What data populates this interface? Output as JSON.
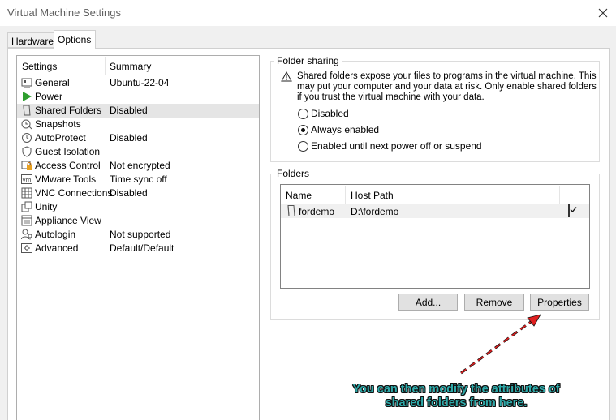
{
  "window": {
    "title": "Virtual Machine Settings"
  },
  "tabs": [
    {
      "label": "Hardware",
      "active": false
    },
    {
      "label": "Options",
      "active": true
    }
  ],
  "settings": {
    "col_settings": "Settings",
    "col_summary": "Summary",
    "items": [
      {
        "label": "General",
        "summary": "Ubuntu-22-04",
        "icon": "general-icon"
      },
      {
        "label": "Power",
        "summary": "",
        "icon": "power-icon"
      },
      {
        "label": "Shared Folders",
        "summary": "Disabled",
        "icon": "shared-folders-icon",
        "selected": true
      },
      {
        "label": "Snapshots",
        "summary": "",
        "icon": "snapshots-icon"
      },
      {
        "label": "AutoProtect",
        "summary": "Disabled",
        "icon": "autoprotect-icon"
      },
      {
        "label": "Guest Isolation",
        "summary": "",
        "icon": "guest-isolation-icon"
      },
      {
        "label": "Access Control",
        "summary": "Not encrypted",
        "icon": "access-control-icon"
      },
      {
        "label": "VMware Tools",
        "summary": "Time sync off",
        "icon": "vmware-tools-icon"
      },
      {
        "label": "VNC Connections",
        "summary": "Disabled",
        "icon": "vnc-icon"
      },
      {
        "label": "Unity",
        "summary": "",
        "icon": "unity-icon"
      },
      {
        "label": "Appliance View",
        "summary": "",
        "icon": "appliance-view-icon"
      },
      {
        "label": "Autologin",
        "summary": "Not supported",
        "icon": "autologin-icon"
      },
      {
        "label": "Advanced",
        "summary": "Default/Default",
        "icon": "advanced-icon"
      }
    ]
  },
  "folder_sharing": {
    "title": "Folder sharing",
    "warning": "Shared folders expose your files to programs in the virtual machine. This may put your computer and your data at risk. Only enable shared folders if you trust the virtual machine with your data.",
    "options": [
      {
        "label": "Disabled",
        "selected": false
      },
      {
        "label": "Always enabled",
        "selected": true
      },
      {
        "label": "Enabled until next power off or suspend",
        "selected": false
      }
    ]
  },
  "folders": {
    "title": "Folders",
    "col_name": "Name",
    "col_host_path": "Host Path",
    "rows": [
      {
        "name": "fordemo",
        "host_path": "D:\\fordemo",
        "enabled": true
      }
    ],
    "add_label": "Add...",
    "remove_label": "Remove",
    "properties_label": "Properties"
  },
  "annotation": {
    "line1": "You can then modify the attributes of",
    "line2": "shared folders from here.",
    "color": "#2eaaaa",
    "arrow_color": "#e02020"
  }
}
